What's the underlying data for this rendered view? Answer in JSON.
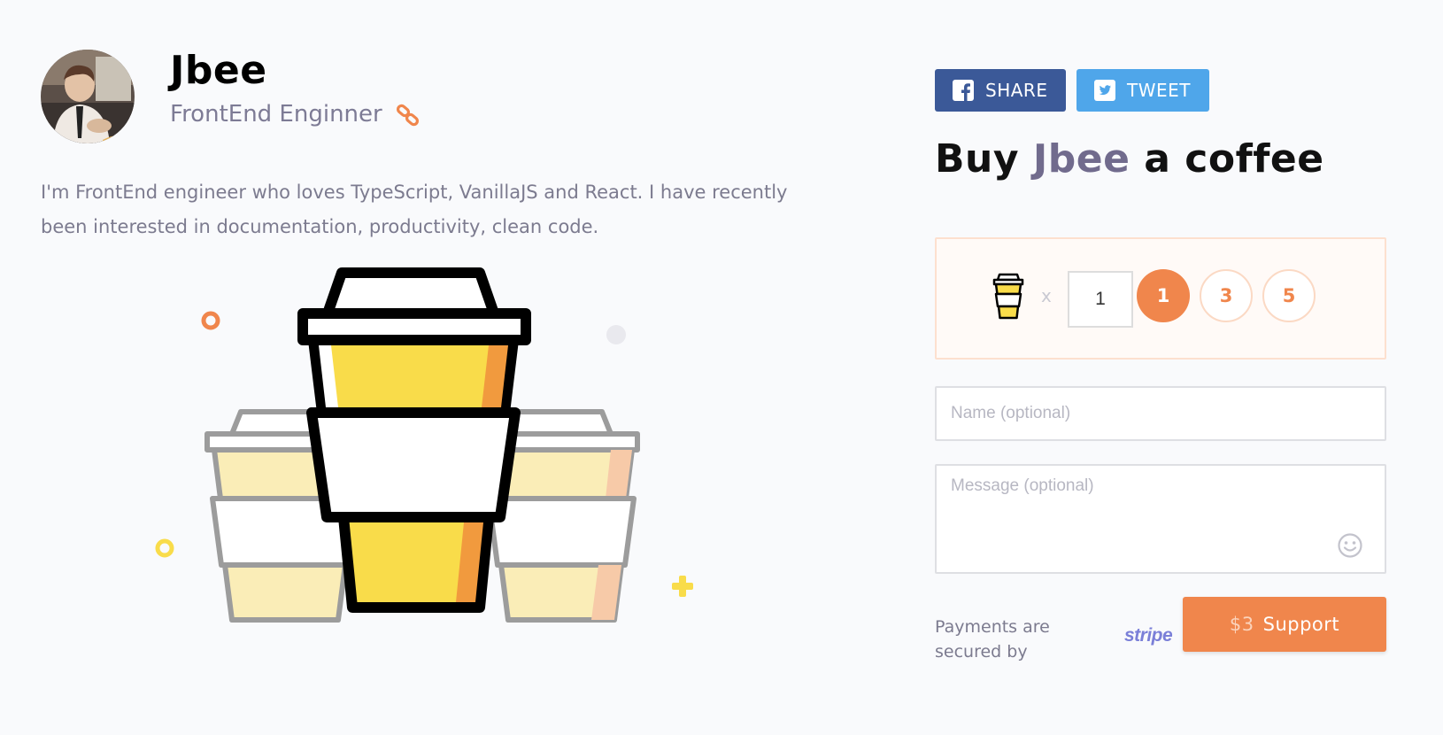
{
  "profile": {
    "name": "Jbee",
    "role": "FrontEnd Enginner",
    "bio": "I'm FrontEnd engineer who loves TypeScript, VanillaJS and React. I have recently been interested in documentation, productivity, clean code."
  },
  "share": {
    "facebook_label": "SHARE",
    "twitter_label": "TWEET"
  },
  "heading": {
    "prefix": "Buy ",
    "name": "Jbee",
    "suffix": " a coffee"
  },
  "order": {
    "times_symbol": "x",
    "quantity": "1",
    "options": [
      "1",
      "3",
      "5"
    ],
    "selected": "1"
  },
  "form": {
    "name_placeholder": "Name (optional)",
    "message_placeholder": "Message (optional)"
  },
  "footer": {
    "secure_text": "Payments are secured by",
    "stripe": "stripe",
    "price": "$3",
    "support_label": "Support"
  },
  "colors": {
    "accent": "#f0864c",
    "facebook": "#3b5998",
    "twitter": "#4fa6ea",
    "name_highlight": "#716b8d",
    "background": "#f9fafc"
  },
  "icons": [
    "link-icon",
    "facebook-icon",
    "twitter-icon",
    "coffee-cup-icon",
    "emoji-icon"
  ]
}
